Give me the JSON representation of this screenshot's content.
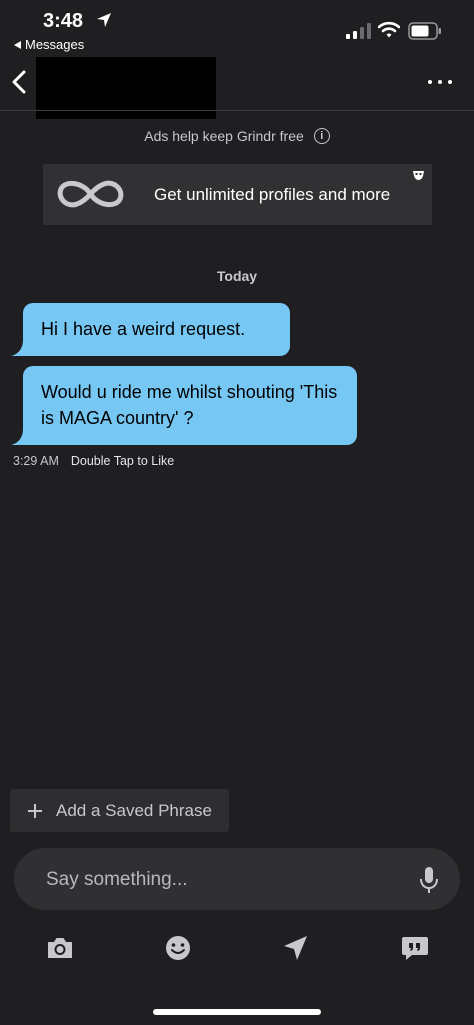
{
  "status_bar": {
    "time": "3:48",
    "back_app": "Messages"
  },
  "header": {
    "contact_name": ""
  },
  "ad": {
    "notice": "Ads help keep Grindr free",
    "card_text": "Get unlimited profiles and more"
  },
  "chat": {
    "date_separator": "Today",
    "messages": [
      {
        "text": "Hi I have a weird request."
      },
      {
        "text": "Would u ride me whilst shouting 'This is MAGA country' ?"
      }
    ],
    "meta": {
      "time": "3:29 AM",
      "hint": "Double Tap to Like"
    }
  },
  "composer": {
    "saved_phrase_label": "Add a Saved Phrase",
    "input_placeholder": "Say something...",
    "input_value": ""
  },
  "icons": {
    "back": "chevron-left-icon",
    "more": "more-icon",
    "info": "info-icon",
    "mic": "microphone-icon",
    "camera": "camera-icon",
    "emoji": "emoji-icon",
    "location": "send-location-icon",
    "phrases": "saved-phrases-icon"
  },
  "colors": {
    "background": "#1f1f21",
    "bubble": "#76c7f4",
    "ad_card": "#313134"
  }
}
